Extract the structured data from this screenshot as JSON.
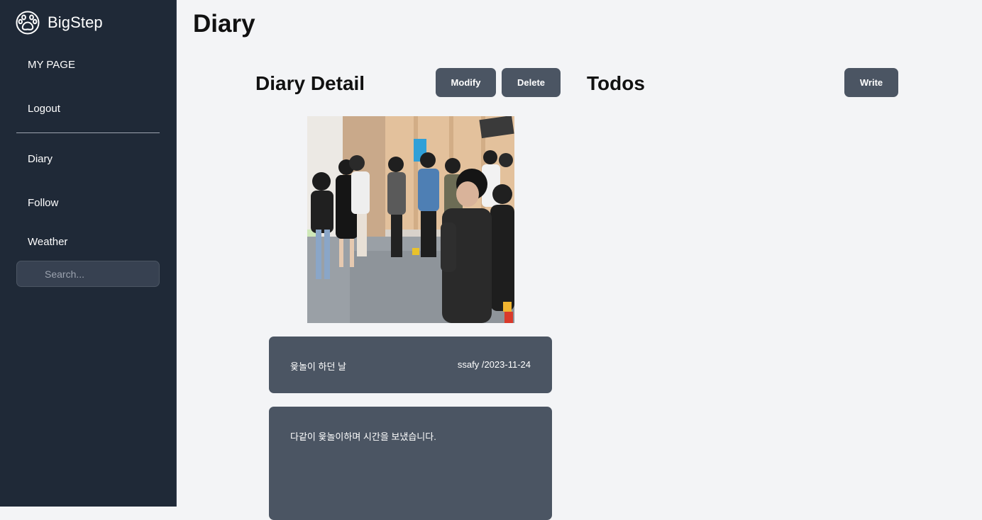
{
  "brand": {
    "name": "BigStep",
    "logo_icon": "paw-icon"
  },
  "sidebar": {
    "items": [
      {
        "label": "MY PAGE"
      },
      {
        "label": "Logout"
      },
      {
        "label": "Diary"
      },
      {
        "label": "Follow"
      },
      {
        "label": "Weather"
      }
    ],
    "search": {
      "placeholder": "Search...",
      "icon": "search-icon"
    }
  },
  "page": {
    "title": "Diary"
  },
  "diary_detail": {
    "heading": "Diary Detail",
    "modify_label": "Modify",
    "delete_label": "Delete",
    "photo": "group-photo",
    "title": "윷놀이 하던 날",
    "meta": "ssafy /2023-11-24",
    "content": "다같이 윷놀이하며 시간을 보냈습니다."
  },
  "todos": {
    "heading": "Todos",
    "write_label": "Write"
  },
  "colors": {
    "sidebar_bg": "#1f2937",
    "page_bg": "#f3f4f6",
    "button_bg": "#4b5563",
    "card_bg": "#4b5563"
  }
}
